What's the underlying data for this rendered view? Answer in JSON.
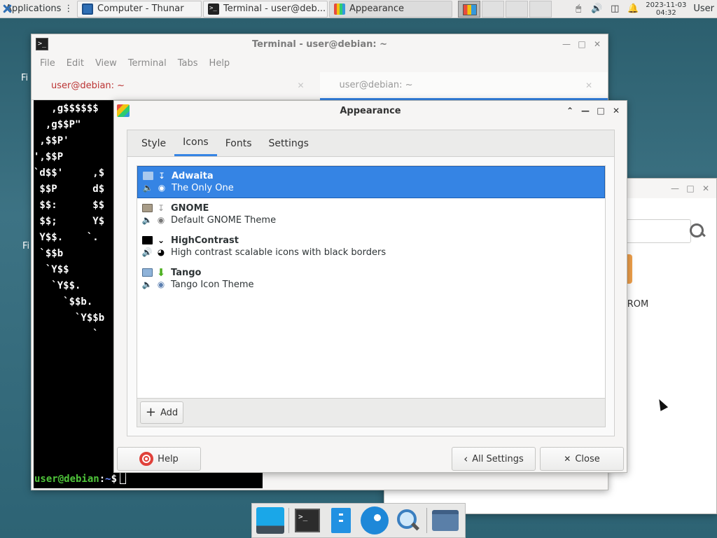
{
  "panel": {
    "applications_label": "Applications",
    "tasks": [
      {
        "label": "Computer - Thunar"
      },
      {
        "label": "Terminal - user@deb..."
      },
      {
        "label": "Appearance"
      }
    ],
    "clock_date": "2023-11-03",
    "clock_time": "04:32",
    "user_label": "User"
  },
  "desktop": {
    "label_fi_top": "Fi",
    "label_fi_bottom": "Fi"
  },
  "thunar": {
    "visible_item_label": "-ROM"
  },
  "terminal": {
    "title": "Terminal - user@debian: ~",
    "menu": [
      "File",
      "Edit",
      "View",
      "Terminal",
      "Tabs",
      "Help"
    ],
    "tabs": [
      {
        "label": "user@debian: ~"
      },
      {
        "label": "user@debian: ~"
      }
    ],
    "art_lines": [
      "   ,g$$$$$$",
      "  ,g$$P\"",
      " ,$$P'",
      "',$$P",
      "`d$$'     ,$",
      " $$P      d$",
      " $$:      $$",
      " $$;      Y$",
      " Y$$.    `.",
      " `$$b      ",
      "  `Y$$",
      "   `Y$$.",
      "     `$$b.",
      "       `Y$$b",
      "          `"
    ],
    "prompt_user": "user@debian",
    "prompt_sep": ":",
    "prompt_path": "~",
    "prompt_symbol": "$"
  },
  "appearance": {
    "title": "Appearance",
    "tabs": [
      "Style",
      "Icons",
      "Fonts",
      "Settings"
    ],
    "active_tab": "Icons",
    "themes": [
      {
        "name": "Adwaita",
        "description": "The Only One",
        "selected": true
      },
      {
        "name": "GNOME",
        "description": "Default GNOME Theme",
        "selected": false
      },
      {
        "name": "HighContrast",
        "description": "High contrast scalable icons with black borders",
        "selected": false
      },
      {
        "name": "Tango",
        "description": "Tango Icon Theme",
        "selected": false
      }
    ],
    "add_label": "Add",
    "help_label": "Help",
    "all_settings_label": "All Settings",
    "close_label": "Close",
    "accent_color": "#3584e4"
  }
}
